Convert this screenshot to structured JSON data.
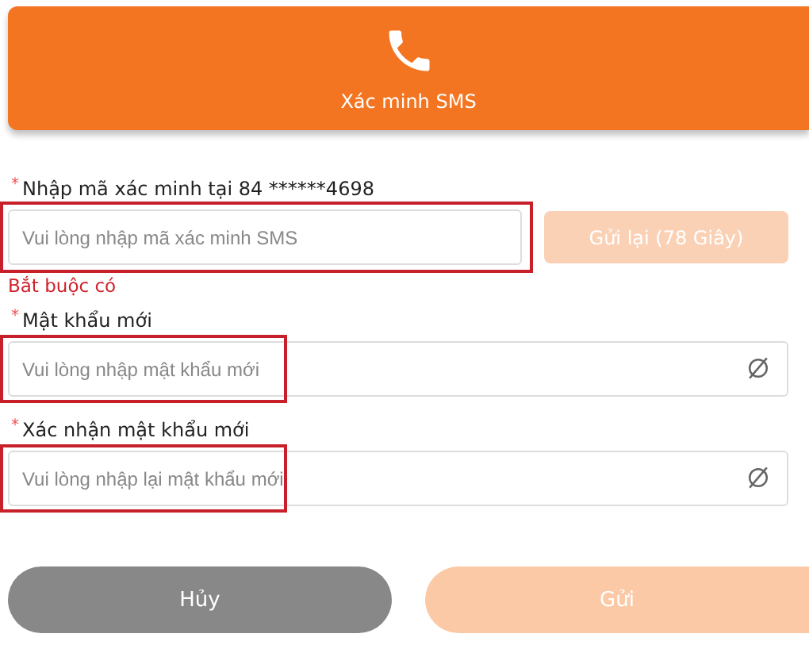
{
  "header": {
    "title": "Xác minh SMS"
  },
  "fields": [
    {
      "kind": "code",
      "required_mark": "*",
      "label": "Nhập mã xác minh tại 84 ******4698",
      "placeholder": "Vui lòng nhập mã xác minh SMS",
      "highlighted": true,
      "resend": {
        "label": "Gửi lại (78 Giây)",
        "disabled": true
      },
      "error": "Bắt buộc có"
    },
    {
      "kind": "password",
      "required_mark": "*",
      "label": "Mật khẩu mới",
      "placeholder": "Vui lòng nhập mật khẩu mới",
      "highlighted": true
    },
    {
      "kind": "password",
      "required_mark": "*",
      "label": "Xác nhận mật khẩu mới",
      "placeholder": "Vui lòng nhập lại mật khẩu mới",
      "highlighted": true
    }
  ],
  "buttons": [
    {
      "kind": "cancel",
      "label": "Hủy",
      "disabled": false
    },
    {
      "kind": "submit",
      "label": "Gửi",
      "disabled": true
    }
  ]
}
